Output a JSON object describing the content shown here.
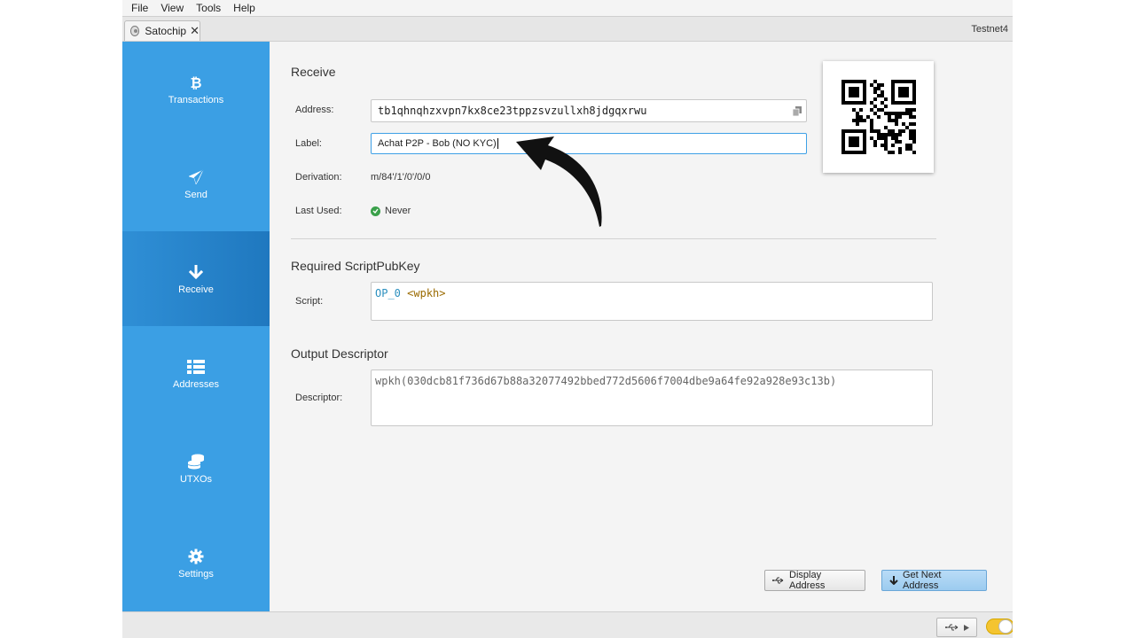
{
  "menu": [
    "File",
    "View",
    "Tools",
    "Help"
  ],
  "tab": {
    "label": "Satochip",
    "close": "✕"
  },
  "network": "Testnet4",
  "sidebar": {
    "items": [
      {
        "label": "Transactions",
        "icon": "bitcoin-icon"
      },
      {
        "label": "Send",
        "icon": "paper-plane-icon"
      },
      {
        "label": "Receive",
        "icon": "arrow-down-icon",
        "active": true
      },
      {
        "label": "Addresses",
        "icon": "list-icon"
      },
      {
        "label": "UTXOs",
        "icon": "coins-icon"
      },
      {
        "label": "Settings",
        "icon": "gear-icon"
      }
    ]
  },
  "receive": {
    "title": "Receive",
    "address_label": "Address:",
    "address": "tb1qhnqhzxvpn7kx8ce23tppzsvzullxh8jdgqxrwu",
    "label_label": "Label:",
    "label_value": "Achat P2P - Bob (NO KYC)",
    "derivation_label": "Derivation:",
    "derivation": "m/84'/1'/0'/0/0",
    "last_used_label": "Last Used:",
    "last_used": "Never"
  },
  "script_section": {
    "title": "Required ScriptPubKey",
    "script_label": "Script:",
    "op": "OP_0",
    "arg": "<wpkh>"
  },
  "descriptor_section": {
    "title": "Output Descriptor",
    "descriptor_label": "Descriptor:",
    "descriptor": "wpkh(030dcb81f736d67b88a32077492bbed772d5606f7004dbe9a64fe92a928e93c13b)"
  },
  "buttons": {
    "display_address": "Display Address",
    "get_next_address": "Get Next Address"
  },
  "colors": {
    "sidebar": "#3b9fe4",
    "sidebar_active": "#1f78bf",
    "focus_border": "#3ea0e6",
    "toggle": "#f4c430"
  }
}
